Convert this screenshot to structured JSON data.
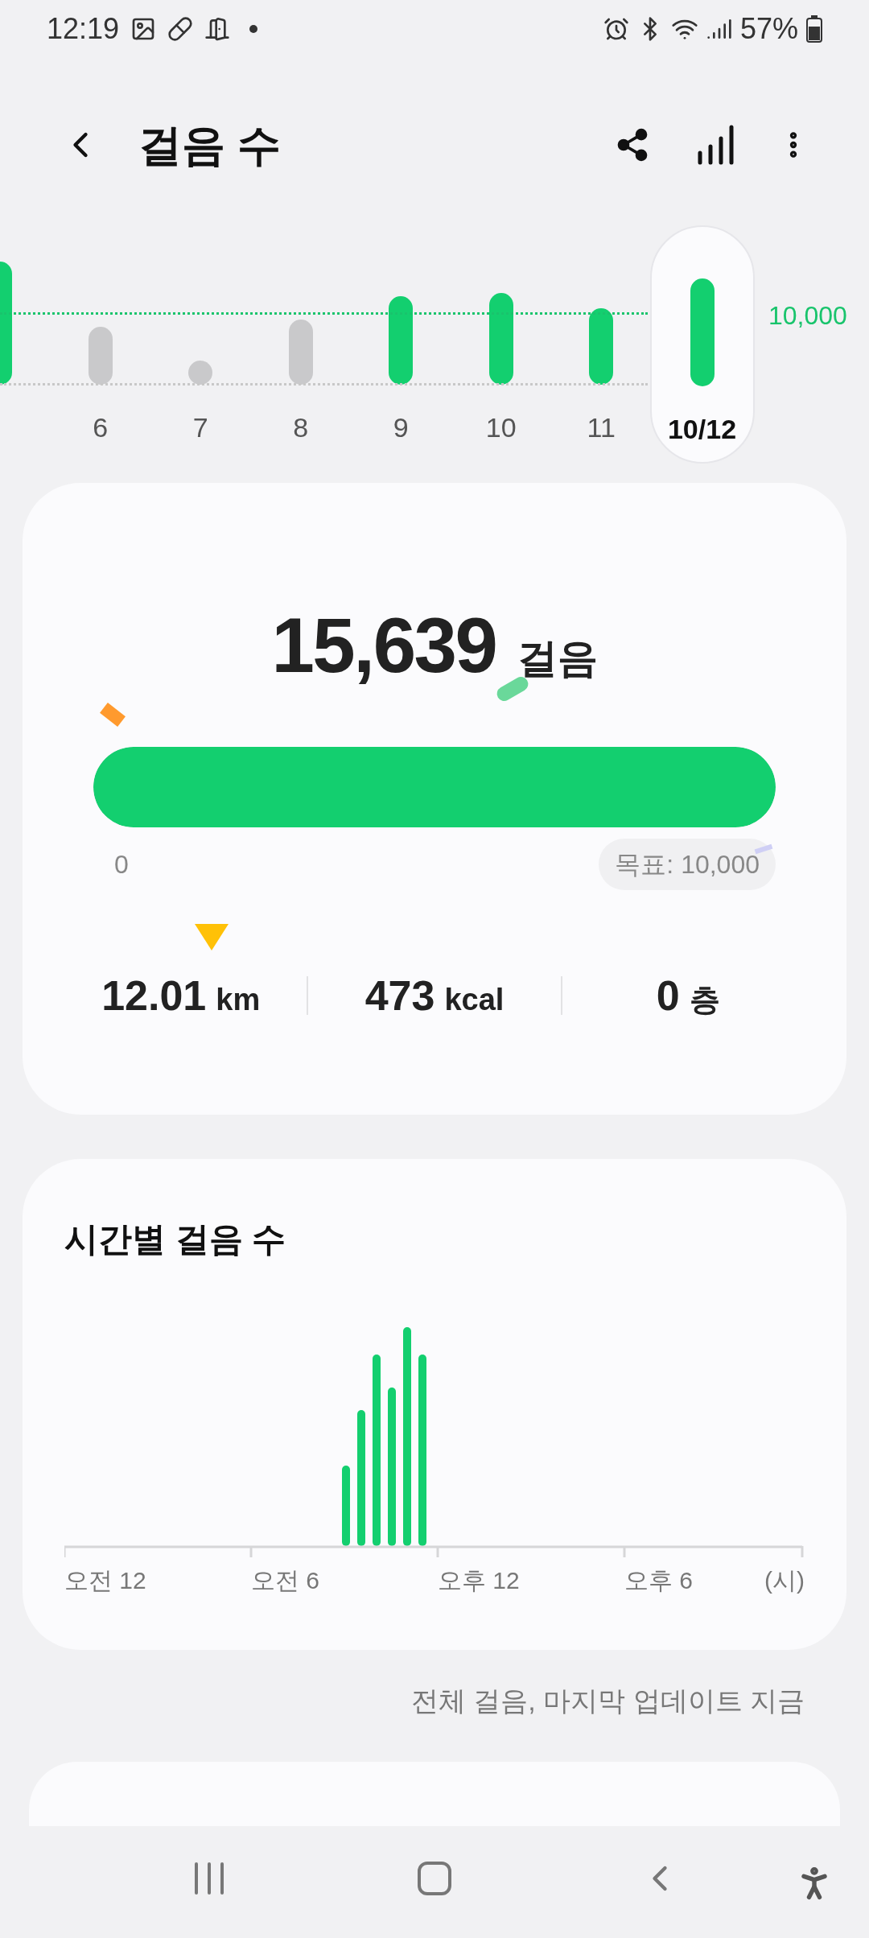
{
  "status_bar": {
    "time": "12:19",
    "battery": "57%"
  },
  "header": {
    "title": "걸음 수"
  },
  "daily_chart": {
    "goal_label": "10,000",
    "days": [
      {
        "achieved": true,
        "selected": false
      },
      {
        "label": "6",
        "achieved": false,
        "selected": false
      },
      {
        "label": "7",
        "achieved": false,
        "selected": false
      },
      {
        "label": "8",
        "achieved": false,
        "selected": false
      },
      {
        "label": "9",
        "achieved": true,
        "selected": false
      },
      {
        "label": "10",
        "achieved": true,
        "selected": false
      },
      {
        "label": "11",
        "achieved": true,
        "selected": false
      },
      {
        "label": "10/12",
        "achieved": true,
        "selected": true
      }
    ]
  },
  "summary": {
    "steps": "15,639",
    "steps_unit": "걸음",
    "level": 1,
    "start_label": "0",
    "goal": "목표: 10,000",
    "stats": [
      {
        "value": "12.01",
        "unit": "km"
      },
      {
        "value": "473",
        "unit": "kcal"
      },
      {
        "value": "0",
        "unit": "층"
      }
    ]
  },
  "hourly": {
    "title": "시간별 걸음 수",
    "axis_labels": [
      "오전 12",
      "오전 6",
      "오후 12",
      "오후 6",
      "(시)"
    ]
  },
  "footer_note": "전체 걸음, 마지막 업데이트 지금"
}
